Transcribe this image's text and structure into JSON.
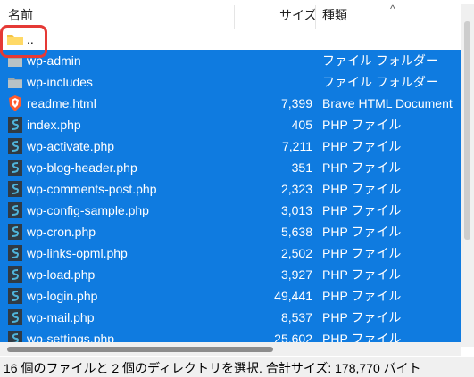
{
  "header": {
    "name_label": "名前",
    "size_label": "サイズ",
    "type_label": "種類",
    "sort_indicator": "^"
  },
  "parent_row": {
    "name": ".."
  },
  "files": [
    {
      "name": "wp-admin",
      "size": "",
      "type": "ファイル フォルダー",
      "icon": "folder-gray-icon"
    },
    {
      "name": "wp-includes",
      "size": "",
      "type": "ファイル フォルダー",
      "icon": "folder-gray-icon"
    },
    {
      "name": "readme.html",
      "size": "7,399",
      "type": "Brave HTML Document",
      "icon": "brave-html-icon"
    },
    {
      "name": "index.php",
      "size": "405",
      "type": "PHP ファイル",
      "icon": "php-file-icon"
    },
    {
      "name": "wp-activate.php",
      "size": "7,211",
      "type": "PHP ファイル",
      "icon": "php-file-icon"
    },
    {
      "name": "wp-blog-header.php",
      "size": "351",
      "type": "PHP ファイル",
      "icon": "php-file-icon"
    },
    {
      "name": "wp-comments-post.php",
      "size": "2,323",
      "type": "PHP ファイル",
      "icon": "php-file-icon"
    },
    {
      "name": "wp-config-sample.php",
      "size": "3,013",
      "type": "PHP ファイル",
      "icon": "php-file-icon"
    },
    {
      "name": "wp-cron.php",
      "size": "5,638",
      "type": "PHP ファイル",
      "icon": "php-file-icon"
    },
    {
      "name": "wp-links-opml.php",
      "size": "2,502",
      "type": "PHP ファイル",
      "icon": "php-file-icon"
    },
    {
      "name": "wp-load.php",
      "size": "3,927",
      "type": "PHP ファイル",
      "icon": "php-file-icon"
    },
    {
      "name": "wp-login.php",
      "size": "49,441",
      "type": "PHP ファイル",
      "icon": "php-file-icon"
    },
    {
      "name": "wp-mail.php",
      "size": "8,537",
      "type": "PHP ファイル",
      "icon": "php-file-icon"
    },
    {
      "name": "wp-settings.php",
      "size": "25,602",
      "type": "PHP ファイル",
      "icon": "php-file-icon"
    }
  ],
  "status": {
    "text": "16 個のファイルと 2 個のディレクトリを選択. 合計サイズ: 178,770 バイト"
  },
  "colors": {
    "selection": "#0f7be0",
    "highlight": "#e53935"
  }
}
